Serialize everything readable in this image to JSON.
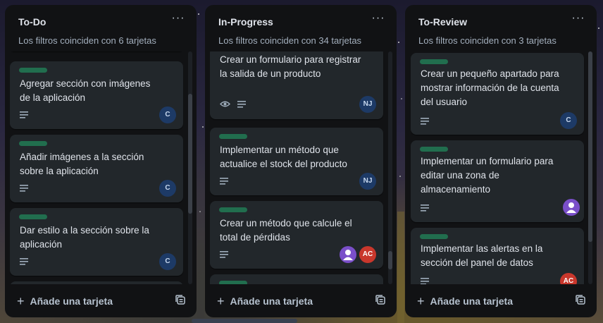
{
  "theme": {
    "list_bg": "#111214",
    "card_bg": "#22272b",
    "label_green": "#216e4e",
    "avatar_blue": "#1d3a66",
    "avatar_red": "#c9372c",
    "avatar_purple": "#7a4fc9"
  },
  "lists": [
    {
      "title": "To-Do",
      "menu": "···",
      "subtitle": "Los filtros coinciden con 6 tarjetas",
      "add_label": "Añade una tarjeta",
      "cards": [
        {
          "label": "green",
          "title": "Agregar sección con imágenes de la aplicación",
          "icons": [
            "description-icon"
          ],
          "members": [
            "C"
          ]
        },
        {
          "label": "green",
          "title": "Añadir imágenes a la sección sobre la aplicación",
          "icons": [
            "description-icon"
          ],
          "members": [
            "C"
          ]
        },
        {
          "label": "green",
          "title": "Dar estilo a la sección sobre la aplicación",
          "icons": [
            "description-icon"
          ],
          "members": [
            "C"
          ]
        }
      ]
    },
    {
      "title": "In-Progress",
      "menu": "···",
      "subtitle": "Los filtros coinciden con 34 tarjetas",
      "add_label": "Añade una tarjeta",
      "cards": [
        {
          "label": "none",
          "title": "Crear un formulario para registrar la salida de un producto",
          "icons": [
            "eye-icon",
            "description-icon"
          ],
          "members": [
            "NJ"
          ]
        },
        {
          "label": "green",
          "title": "Implementar un método que actualice el stock del producto",
          "icons": [
            "description-icon"
          ],
          "members": [
            "NJ"
          ]
        },
        {
          "label": "green",
          "title": "Crear un método que calcule el total de pérdidas",
          "icons": [
            "description-icon"
          ],
          "members": [
            "user-avatar",
            "AC"
          ]
        },
        {
          "label": "green",
          "title": "",
          "icons": [],
          "members": []
        }
      ]
    },
    {
      "title": "To-Review",
      "menu": "···",
      "subtitle": "Los filtros coinciden con 3 tarjetas",
      "add_label": "Añade una tarjeta",
      "cards": [
        {
          "label": "green",
          "title": "Crear un pequeño apartado para mostrar información de la cuenta del usuario",
          "icons": [
            "description-icon"
          ],
          "members": [
            "C"
          ]
        },
        {
          "label": "green",
          "title": "Implementar un formulario para editar una zona de almacenamiento",
          "icons": [
            "description-icon"
          ],
          "members": [
            "user-avatar"
          ]
        },
        {
          "label": "green",
          "title": "Implementar las alertas en la sección del panel de datos",
          "icons": [
            "description-icon"
          ],
          "members": [
            "AC"
          ]
        }
      ]
    }
  ]
}
